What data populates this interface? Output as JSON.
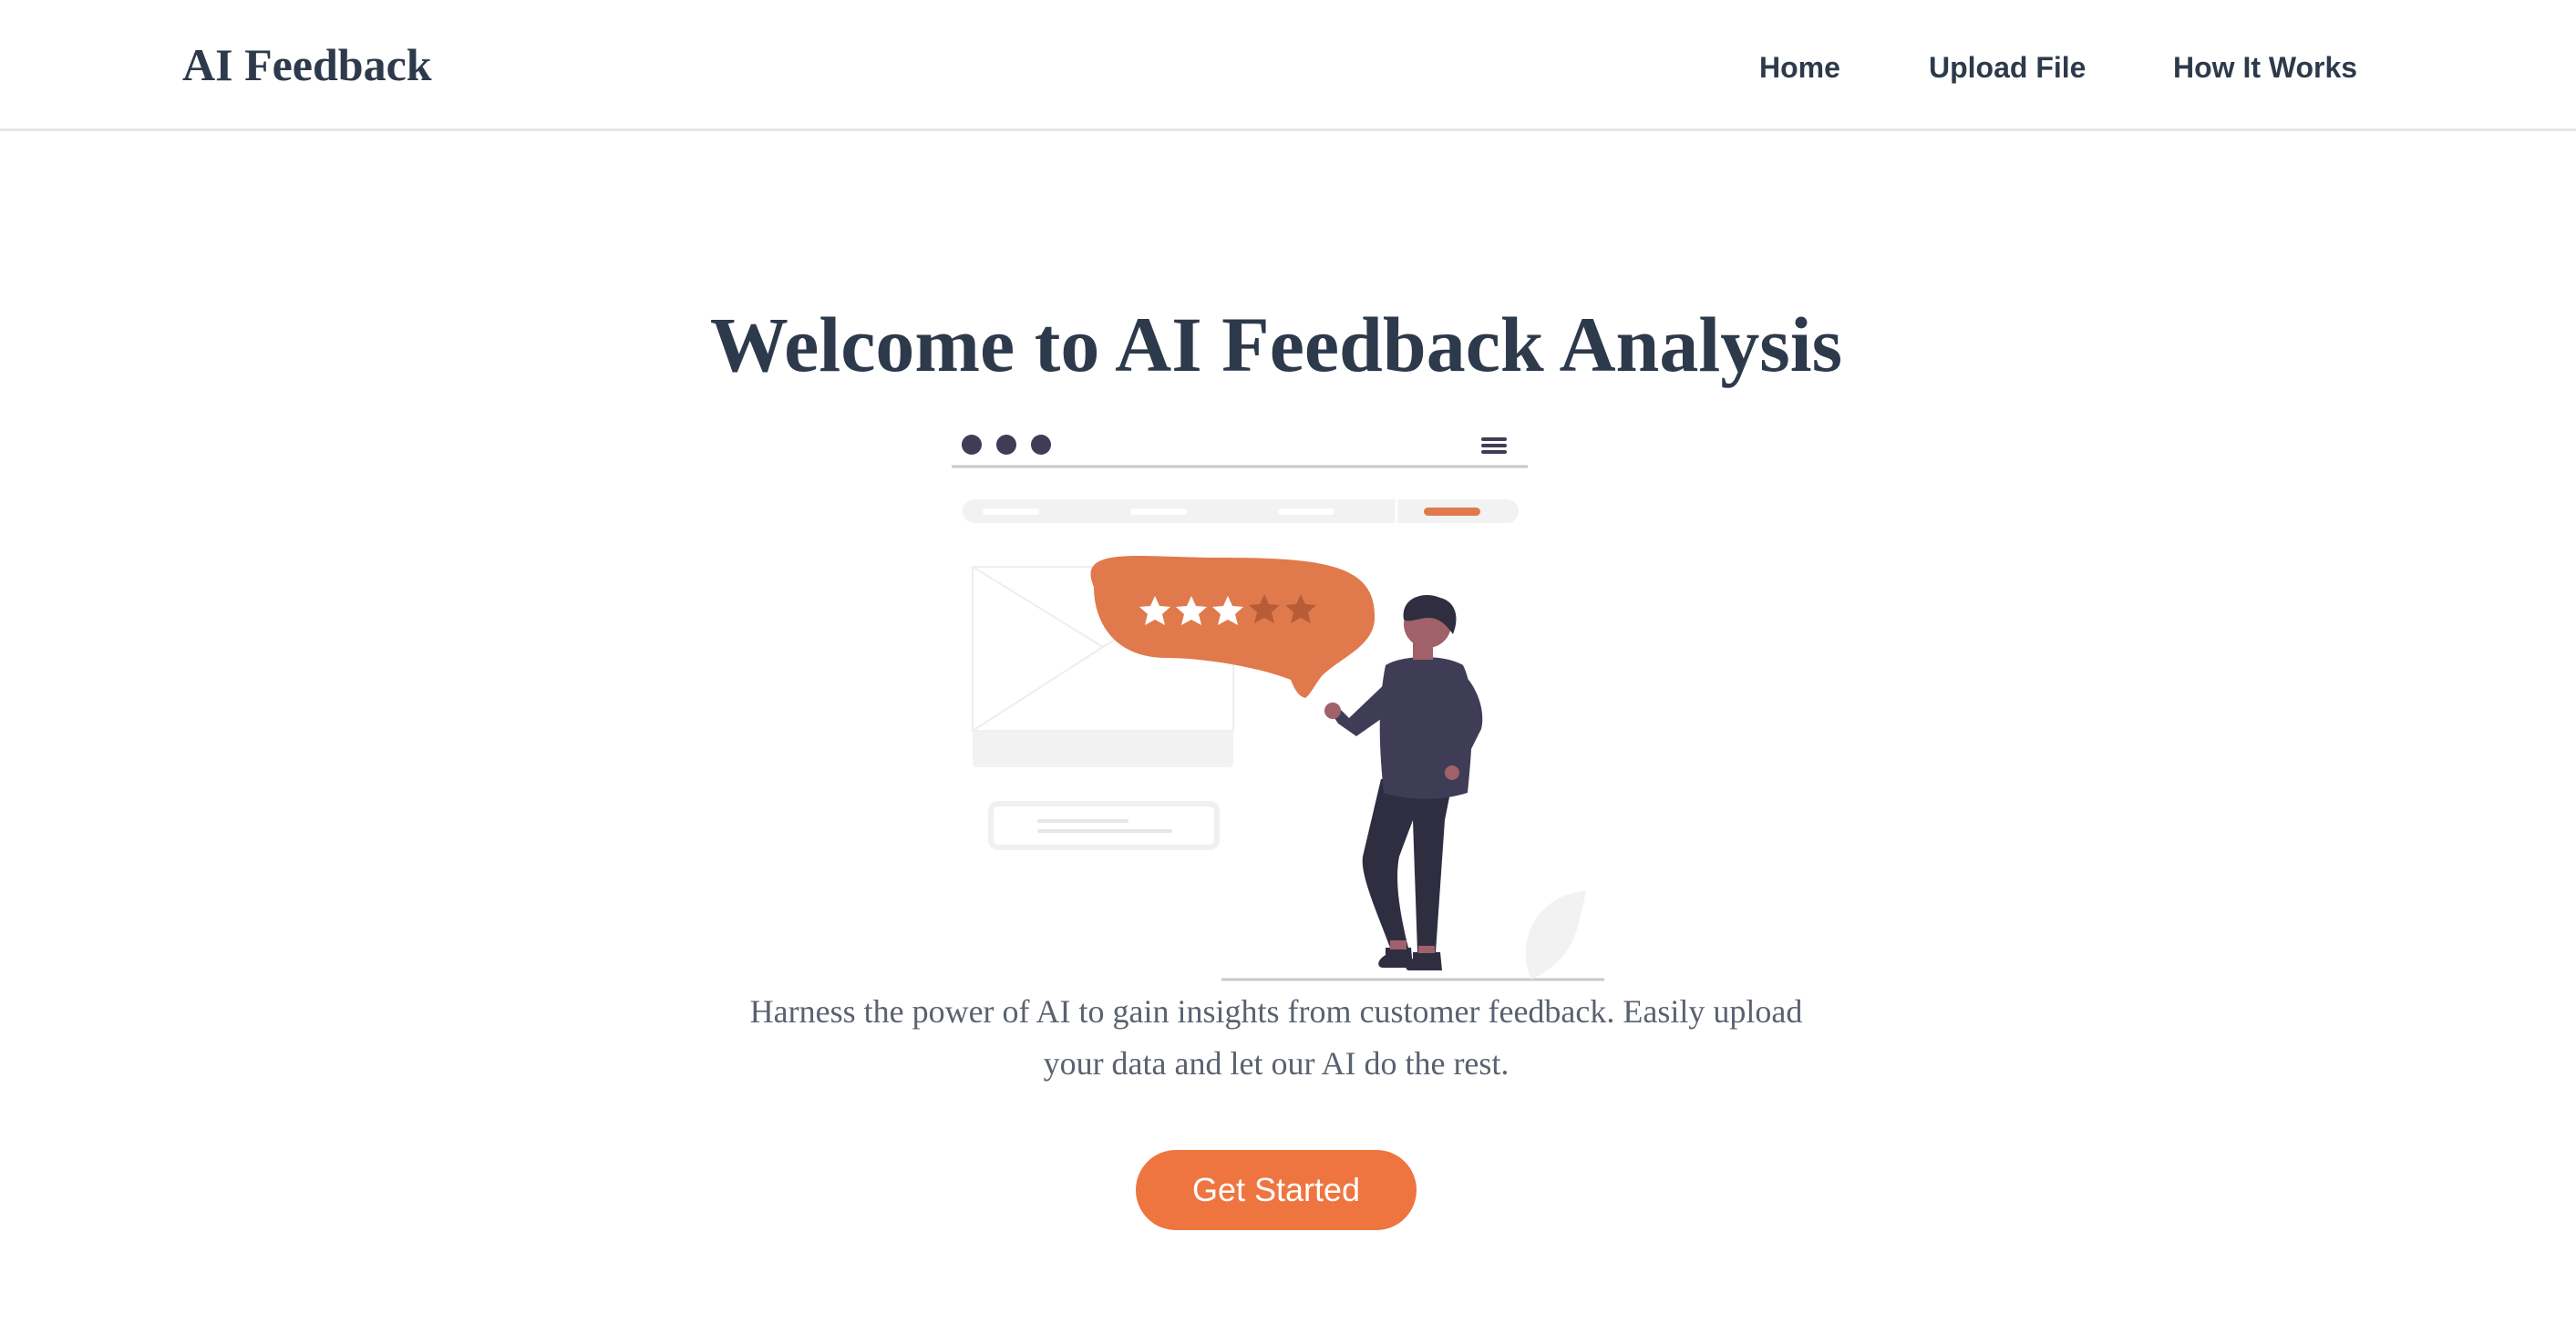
{
  "header": {
    "brand": "AI Feedback",
    "nav": {
      "home": "Home",
      "upload": "Upload File",
      "how": "How It Works"
    }
  },
  "hero": {
    "title": "Welcome to AI Feedback Analysis",
    "description": "Harness the power of AI to gain insights from customer feedback. Easily upload your data and let our AI do the rest.",
    "cta": "Get Started"
  },
  "illustration": {
    "name": "feedback-rating-illustration",
    "rating": 3,
    "rating_max": 5,
    "colors": {
      "accent": "#e07a4c",
      "accent_dark": "#b85c38",
      "figure": "#3f3d56",
      "figure_dark": "#2f2e41",
      "skin": "#a0616a",
      "muted": "#f2f2f2"
    }
  },
  "colors": {
    "text": "#2d3a4b",
    "body_text": "#5a6270",
    "button": "#ef7540",
    "border": "#e3e6ea"
  }
}
